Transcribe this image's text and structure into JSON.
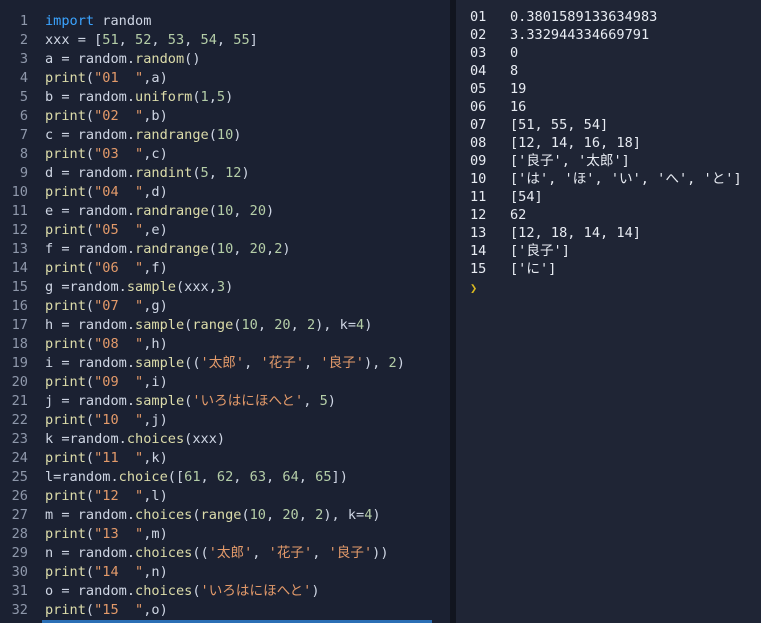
{
  "editor": {
    "lines": [
      {
        "n": "1",
        "code": "import random"
      },
      {
        "n": "2",
        "code": "xxx = [51, 52, 53, 54, 55]"
      },
      {
        "n": "3",
        "code": "a = random.random()"
      },
      {
        "n": "4",
        "code": "print(\"01  \",a)"
      },
      {
        "n": "5",
        "code": "b = random.uniform(1,5)"
      },
      {
        "n": "6",
        "code": "print(\"02  \",b)"
      },
      {
        "n": "7",
        "code": "c = random.randrange(10)"
      },
      {
        "n": "8",
        "code": "print(\"03  \",c)"
      },
      {
        "n": "9",
        "code": "d = random.randint(5, 12)"
      },
      {
        "n": "10",
        "code": "print(\"04  \",d)"
      },
      {
        "n": "11",
        "code": "e = random.randrange(10, 20)"
      },
      {
        "n": "12",
        "code": "print(\"05  \",e)"
      },
      {
        "n": "13",
        "code": "f = random.randrange(10, 20,2)"
      },
      {
        "n": "14",
        "code": "print(\"06  \",f)"
      },
      {
        "n": "15",
        "code": "g =random.sample(xxx,3)"
      },
      {
        "n": "16",
        "code": "print(\"07  \",g)"
      },
      {
        "n": "17",
        "code": "h = random.sample(range(10, 20, 2), k=4)"
      },
      {
        "n": "18",
        "code": "print(\"08  \",h)"
      },
      {
        "n": "19",
        "code": "i = random.sample(('太郎', '花子', '良子'), 2)"
      },
      {
        "n": "20",
        "code": "print(\"09  \",i)"
      },
      {
        "n": "21",
        "code": "j = random.sample('いろはにほへと', 5)"
      },
      {
        "n": "22",
        "code": "print(\"10  \",j)"
      },
      {
        "n": "23",
        "code": "k =random.choices(xxx)"
      },
      {
        "n": "24",
        "code": "print(\"11  \",k)"
      },
      {
        "n": "25",
        "code": "l=random.choice([61, 62, 63, 64, 65])"
      },
      {
        "n": "26",
        "code": "print(\"12  \",l)"
      },
      {
        "n": "27",
        "code": "m = random.choices(range(10, 20, 2), k=4)"
      },
      {
        "n": "28",
        "code": "print(\"13  \",m)"
      },
      {
        "n": "29",
        "code": "n = random.choices(('太郎', '花子', '良子'))"
      },
      {
        "n": "30",
        "code": "print(\"14  \",n)"
      },
      {
        "n": "31",
        "code": "o = random.choices('いろはにほへと')"
      },
      {
        "n": "32",
        "code": "print(\"15  \",o)"
      }
    ]
  },
  "output": {
    "lines": [
      {
        "num": "01",
        "val": "0.3801589133634983"
      },
      {
        "num": "02",
        "val": "3.332944334669791"
      },
      {
        "num": "03",
        "val": "0"
      },
      {
        "num": "04",
        "val": "8"
      },
      {
        "num": "05",
        "val": "19"
      },
      {
        "num": "06",
        "val": "16"
      },
      {
        "num": "07",
        "val": "[51, 55, 54]"
      },
      {
        "num": "08",
        "val": "[12, 14, 16, 18]"
      },
      {
        "num": "09",
        "val": "['良子', '太郎']"
      },
      {
        "num": "10",
        "val": "['は', 'ほ', 'い', 'へ', 'と']"
      },
      {
        "num": "11",
        "val": "[54]"
      },
      {
        "num": "12",
        "val": "62"
      },
      {
        "num": "13",
        "val": "[12, 18, 14, 14]"
      },
      {
        "num": "14",
        "val": "['良子']"
      },
      {
        "num": "15",
        "val": "['に']"
      }
    ],
    "prompt": "❯"
  },
  "colors": {
    "keyword": "#3ba4ff",
    "string": "#e39a6a",
    "number": "#b5cea8",
    "text": "#cfd6e4"
  }
}
